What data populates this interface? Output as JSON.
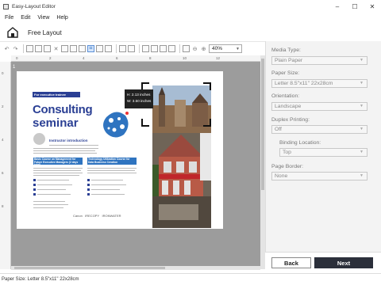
{
  "window": {
    "title": "Easy-Layout Editor",
    "minimize": "–",
    "maximize": "☐",
    "close": "✕"
  },
  "menu": [
    "File",
    "Edit",
    "View",
    "Help"
  ],
  "header": {
    "mode": "Free Layout"
  },
  "toolbar": {
    "zoom": "40%"
  },
  "rulers": {
    "h": [
      "0",
      "2",
      "4",
      "6",
      "8",
      "10",
      "12"
    ],
    "v": [
      "0",
      "2",
      "4",
      "6",
      "8"
    ],
    "page_number": "1"
  },
  "brochure": {
    "tag": "For executive trainee",
    "title_line1": "Consulting",
    "title_line2": "seminar",
    "instructor": "Instructor introduction",
    "box1": "Basic Course on Management for Future Executive Managers (2 days total)",
    "box2": "Technology Utilization Course for Data Business Creation",
    "logos": [
      "Canon",
      "IRECOPY",
      "IRONWATER"
    ]
  },
  "tooltip": {
    "height": "H: 2.13 inches",
    "width": "W: 3.50 inches"
  },
  "settings": {
    "media_type_label": "Media Type:",
    "media_type": "Plain Paper",
    "paper_size_label": "Paper Size:",
    "paper_size": "Letter 8.5\"x11\" 22x28cm",
    "orientation_label": "Orientation:",
    "orientation": "Landscape",
    "duplex_label": "Duplex Printing:",
    "duplex": "Off",
    "binding_label": "Binding Location:",
    "binding": "Top",
    "border_label": "Page Border:",
    "border": "None"
  },
  "buttons": {
    "back": "Back",
    "next": "Next"
  },
  "status": "Paper Size: Letter 8.5\"x11\" 22x28cm",
  "colors": {
    "brand": "#2a3f94",
    "next_button": "#2b2f3a"
  }
}
